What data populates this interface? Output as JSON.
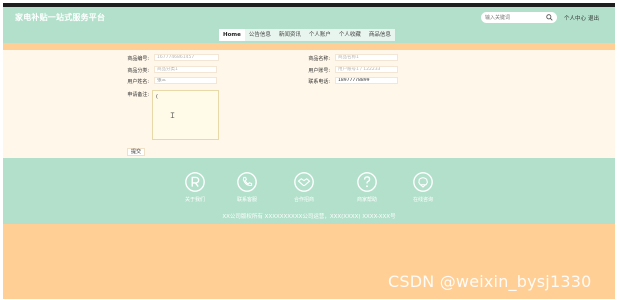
{
  "header": {
    "brand": "家电补贴一站式服务平台",
    "search_placeholder": "输入关键词",
    "personal_center": "个人中心",
    "logout": "退出"
  },
  "nav": {
    "items": [
      {
        "label": "Home",
        "active": true
      },
      {
        "label": "公告信息",
        "active": false
      },
      {
        "label": "新闻资讯",
        "active": false
      },
      {
        "label": "个人账户",
        "active": false
      },
      {
        "label": "个人收藏",
        "active": false
      },
      {
        "label": "商品信息",
        "active": false
      }
    ]
  },
  "form": {
    "product_no_label": "商品编号:",
    "product_no_value": "1677746861457",
    "product_name_label": "商品名称:",
    "product_name_placeholder": "商品名称1",
    "product_category_label": "商品分类:",
    "product_category_placeholder": "商品分类1",
    "user_account_label": "用户账号:",
    "user_account_placeholder": "用户账号1 / 122233",
    "user_name_label": "用户姓名:",
    "user_name_value": "张三",
    "phone_label": "联系电话:",
    "phone_value": "18977778899",
    "remark_label": "申请备注:",
    "remark_value": "(",
    "submit_label": "提交"
  },
  "footer": {
    "items": [
      {
        "label": "关于我们",
        "icon": "r-circle-icon"
      },
      {
        "label": "联系客服",
        "icon": "phone-icon"
      },
      {
        "label": "合作招商",
        "icon": "handshake-icon"
      },
      {
        "label": "商家帮助",
        "icon": "question-icon"
      },
      {
        "label": "在线咨询",
        "icon": "headset-icon"
      }
    ],
    "copyright": "XX公司版权所有 XXXXXXXXXX公司运营，XXX(XXXX) XXXX-XXX号"
  },
  "watermark": "CSDN @weixin_bysj1330",
  "colors": {
    "mint": "#b2e0cb",
    "peach": "#ffcf96",
    "cream": "#fff7ea"
  }
}
